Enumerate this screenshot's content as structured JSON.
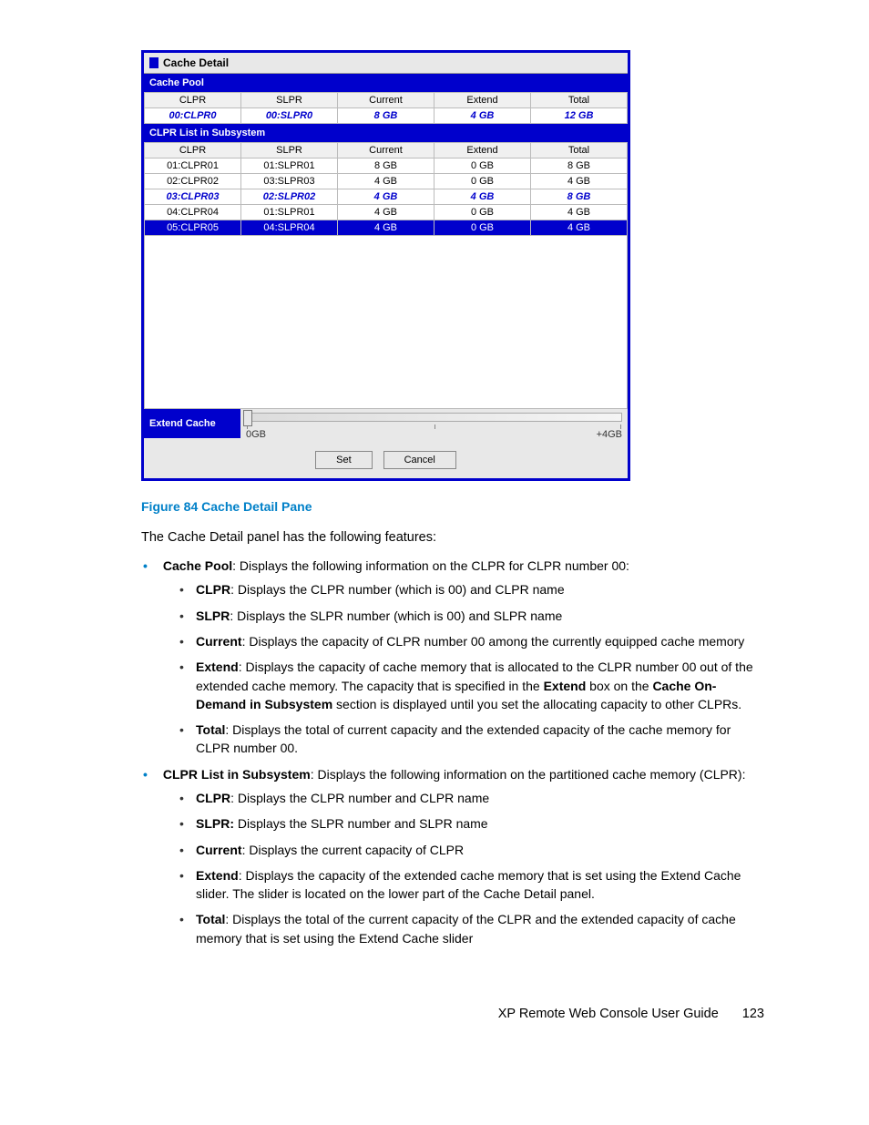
{
  "panel": {
    "title": "Cache Detail",
    "pool_section": "Cache Pool",
    "pool_headers": [
      "CLPR",
      "SLPR",
      "Current",
      "Extend",
      "Total"
    ],
    "pool_row": [
      "00:CLPR0",
      "00:SLPR0",
      "8 GB",
      "4 GB",
      "12 GB"
    ],
    "list_section": "CLPR List in Subsystem",
    "list_headers": [
      "CLPR",
      "SLPR",
      "Current",
      "Extend",
      "Total"
    ],
    "list_rows": [
      [
        "01:CLPR01",
        "01:SLPR01",
        "8 GB",
        "0 GB",
        "8 GB"
      ],
      [
        "02:CLPR02",
        "03:SLPR03",
        "4 GB",
        "0 GB",
        "4 GB"
      ],
      [
        "03:CLPR03",
        "02:SLPR02",
        "4 GB",
        "4 GB",
        "8 GB"
      ],
      [
        "04:CLPR04",
        "01:SLPR01",
        "4 GB",
        "0 GB",
        "4 GB"
      ],
      [
        "05:CLPR05",
        "04:SLPR04",
        "4 GB",
        "0 GB",
        "4 GB"
      ]
    ],
    "extend_label": "Extend Cache",
    "slider_min": "0GB",
    "slider_max": "+4GB",
    "btn_set": "Set",
    "btn_cancel": "Cancel"
  },
  "caption": "Figure 84 Cache Detail Pane",
  "intro": "The Cache Detail panel has the following features:",
  "bullets": {
    "b1": {
      "lead": "Cache Pool",
      "text": ": Displays the following information on the CLPR for CLPR number 00:",
      "sub": {
        "s1": {
          "k": "CLPR",
          "t": ": Displays the CLPR number (which is 00) and CLPR name"
        },
        "s2": {
          "k": "SLPR",
          "t": ": Displays the SLPR number (which is 00) and SLPR name"
        },
        "s3": {
          "k": "Current",
          "t": ": Displays the capacity of CLPR number 00 among the currently equipped cache memory"
        },
        "s4": {
          "k": "Extend",
          "t1": ": Displays the capacity of cache memory that is allocated to the CLPR number 00 out of the extended cache memory. The capacity that is specified in the ",
          "k2": "Extend",
          "t2": " box on the ",
          "k3": "Cache On-Demand in Subsystem",
          "t3": " section is displayed until you set the allocating capacity to other CLPRs."
        },
        "s5": {
          "k": "Total",
          "t": ": Displays the total of current capacity and the extended capacity of the cache memory for CLPR number 00."
        }
      }
    },
    "b2": {
      "lead": "CLPR List in Subsystem",
      "text": ": Displays the following information on the partitioned cache memory (CLPR):",
      "sub": {
        "s1": {
          "k": "CLPR",
          "t": ": Displays the CLPR number and CLPR name"
        },
        "s2": {
          "k": "SLPR:",
          "t": " Displays the SLPR number and SLPR name"
        },
        "s3": {
          "k": "Current",
          "t": ": Displays the current capacity of CLPR"
        },
        "s4": {
          "k": "Extend",
          "t": ": Displays the capacity of the extended cache memory that is set using the Extend Cache slider. The slider is located on the lower part of the Cache Detail panel."
        },
        "s5": {
          "k": "Total",
          "t": ": Displays the total of the current capacity of the CLPR and the extended capacity of cache memory that is set using the Extend Cache slider"
        }
      }
    }
  },
  "footer": {
    "title": "XP Remote Web Console User Guide",
    "page": "123"
  }
}
